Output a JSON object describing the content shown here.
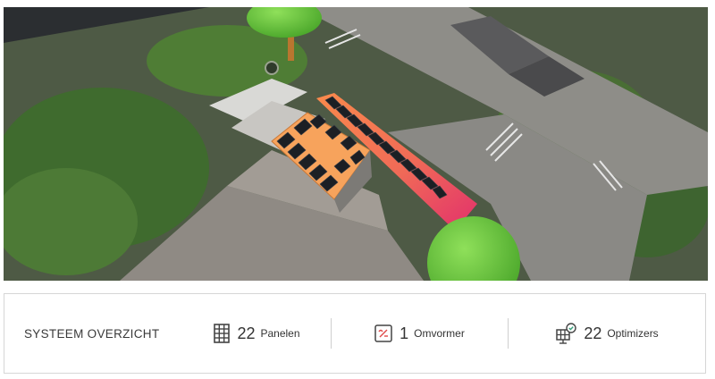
{
  "summary": {
    "title": "SYSTEEM OVERZICHT",
    "stats": [
      {
        "count": "22",
        "label": "Panelen",
        "icon": "solar-panel-grid-icon"
      },
      {
        "count": "1",
        "label": "Omvormer",
        "icon": "inverter-icon"
      },
      {
        "count": "22",
        "label": "Optimizers",
        "icon": "optimizer-icon"
      }
    ]
  },
  "colors": {
    "roof_orange": "#f7a35c",
    "roof_gradient_start": "#f9874a",
    "roof_gradient_end": "#e0306e",
    "panel": "#1c1f24",
    "inverter_red": "#e04a4a",
    "optimizer_green": "#3aa17e"
  }
}
